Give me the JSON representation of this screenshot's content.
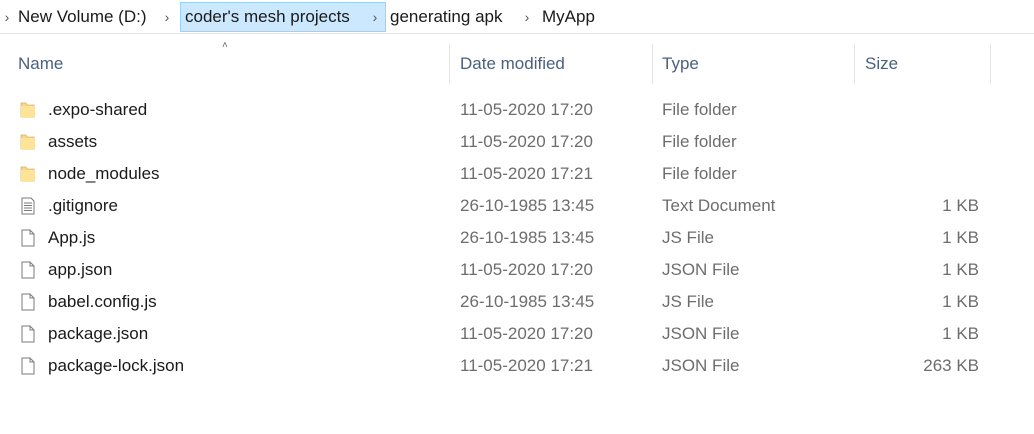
{
  "breadcrumb": {
    "items": [
      {
        "label": "New Volume (D:)"
      },
      {
        "label": "coder's mesh projects"
      },
      {
        "label": "generating apk"
      },
      {
        "label": "MyApp"
      }
    ]
  },
  "columns": {
    "name": "Name",
    "date": "Date modified",
    "type": "Type",
    "size": "Size"
  },
  "files": [
    {
      "name": ".expo-shared",
      "date": "11-05-2020 17:20",
      "type": "File folder",
      "size": "",
      "icon": "folder-icon"
    },
    {
      "name": "assets",
      "date": "11-05-2020 17:20",
      "type": "File folder",
      "size": "",
      "icon": "folder-icon"
    },
    {
      "name": "node_modules",
      "date": "11-05-2020 17:21",
      "type": "File folder",
      "size": "",
      "icon": "folder-icon"
    },
    {
      "name": ".gitignore",
      "date": "26-10-1985 13:45",
      "type": "Text Document",
      "size": "1 KB",
      "icon": "text-document-icon"
    },
    {
      "name": "App.js",
      "date": "26-10-1985 13:45",
      "type": "JS File",
      "size": "1 KB",
      "icon": "file-icon"
    },
    {
      "name": "app.json",
      "date": "11-05-2020 17:20",
      "type": "JSON File",
      "size": "1 KB",
      "icon": "file-icon"
    },
    {
      "name": "babel.config.js",
      "date": "26-10-1985 13:45",
      "type": "JS File",
      "size": "1 KB",
      "icon": "file-icon"
    },
    {
      "name": "package.json",
      "date": "11-05-2020 17:20",
      "type": "JSON File",
      "size": "1 KB",
      "icon": "file-icon"
    },
    {
      "name": "package-lock.json",
      "date": "11-05-2020 17:21",
      "type": "JSON File",
      "size": "263 KB",
      "icon": "file-icon"
    }
  ],
  "colors": {
    "selected_crumb_bg": "#cce8ff",
    "selected_crumb_border": "#99d1ff",
    "folder": "#f8d775",
    "header_text": "#4c607a"
  }
}
